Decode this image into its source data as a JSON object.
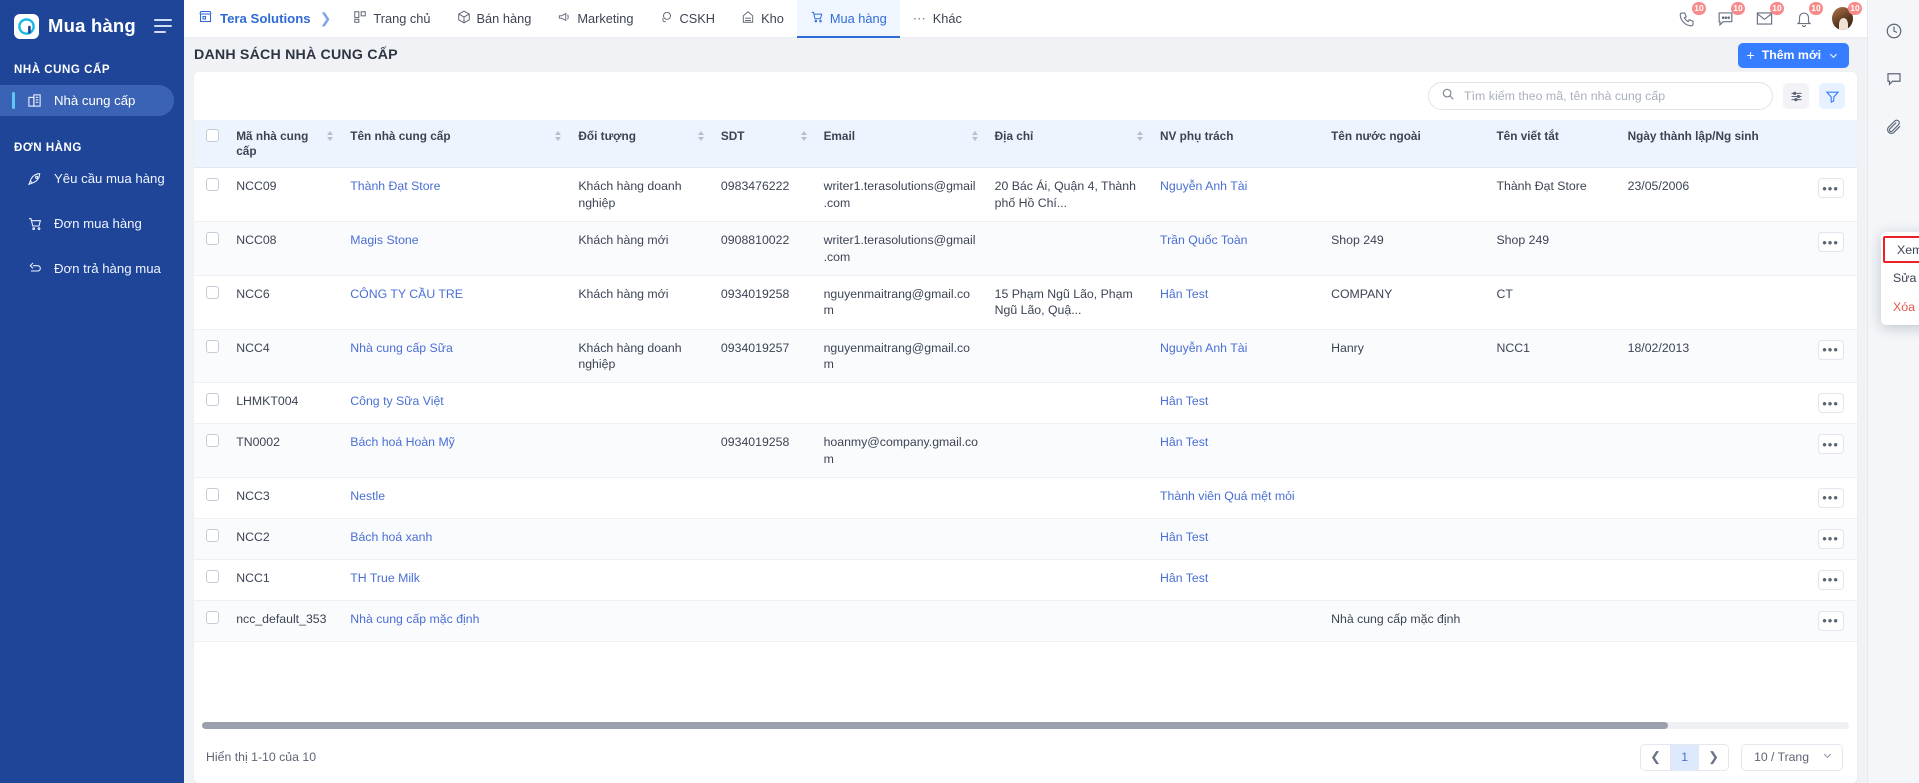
{
  "sidebar": {
    "app_title": "Mua hàng",
    "groups": [
      {
        "label": "NHÀ CUNG CẤP",
        "items": [
          {
            "label": "Nhà cung cấp",
            "icon": "building-icon",
            "active": true
          }
        ]
      },
      {
        "label": "ĐƠN HÀNG",
        "items": [
          {
            "label": "Yêu cầu mua hàng",
            "icon": "rocket-icon",
            "active": false
          },
          {
            "label": "Đơn mua hàng",
            "icon": "cart-icon",
            "active": false
          },
          {
            "label": "Đơn trả hàng mua",
            "icon": "return-arrow-icon",
            "active": false
          }
        ]
      }
    ]
  },
  "topnav": {
    "brand": "Tera Solutions",
    "items": [
      {
        "label": "Trang chủ",
        "icon": "dashboard-icon",
        "active": false
      },
      {
        "label": "Bán hàng",
        "icon": "box-icon",
        "active": false
      },
      {
        "label": "Marketing",
        "icon": "megaphone-icon",
        "active": false
      },
      {
        "label": "CSKH",
        "icon": "headset-icon",
        "active": false
      },
      {
        "label": "Kho",
        "icon": "warehouse-icon",
        "active": false
      },
      {
        "label": "Mua hàng",
        "icon": "cart-icon",
        "active": true
      },
      {
        "label": "Khác",
        "icon": "dots-icon",
        "active": false
      }
    ],
    "actions": [
      {
        "name": "phone-icon",
        "badge": "10"
      },
      {
        "name": "chat-icon",
        "badge": "10"
      },
      {
        "name": "mail-icon",
        "badge": "10"
      },
      {
        "name": "bell-icon",
        "badge": "10"
      },
      {
        "name": "avatar",
        "badge": "10"
      }
    ]
  },
  "page": {
    "title": "DANH SÁCH NHÀ CUNG CẤP",
    "add_button": "Thêm mới"
  },
  "toolbar": {
    "search_placeholder": "Tìm kiếm theo mã, tên nhà cung cấp",
    "search_value": "",
    "settings_icon": "sliders-icon",
    "filter_icon": "funnel-icon"
  },
  "table": {
    "columns": [
      {
        "label": "Mã nhà cung cấp",
        "sortable": true
      },
      {
        "label": "Tên nhà cung cấp",
        "sortable": true
      },
      {
        "label": "Đối tượng",
        "sortable": true
      },
      {
        "label": "SDT",
        "sortable": true
      },
      {
        "label": "Email",
        "sortable": true
      },
      {
        "label": "Địa chỉ",
        "sortable": true
      },
      {
        "label": "NV phụ trách",
        "sortable": false
      },
      {
        "label": "Tên nước ngoài",
        "sortable": false
      },
      {
        "label": "Tên viết tắt",
        "sortable": false
      },
      {
        "label": "Ngày thành lập/Ng sinh",
        "sortable": false
      }
    ],
    "rows": [
      {
        "code": "NCC09",
        "name": "Thành Đạt Store",
        "object": "Khách hàng doanh nghiệp",
        "phone": "0983476222",
        "email": "writer1.terasolutions@gmail.com",
        "address": "20 Bác Ái, Quận 4, Thành phố Hồ Chí...",
        "staff": "Nguyễn Anh Tài",
        "foreign_name": "",
        "short_name": "Thành Đạt Store",
        "date": "23/05/2006"
      },
      {
        "code": "NCC08",
        "name": "Magis Stone",
        "object": "Khách hàng mới",
        "phone": "0908810022",
        "email": "writer1.terasolutions@gmail.com",
        "address": "",
        "staff": "Trần Quốc Toàn",
        "foreign_name": "Shop 249",
        "short_name": "Shop 249",
        "date": ""
      },
      {
        "code": "NCC6",
        "name": "CÔNG TY CẦU TRE",
        "object": "Khách hàng mới",
        "phone": "0934019258",
        "email": "nguyenmaitrang@gmail.com",
        "address": "15 Phạm Ngũ Lão, Phạm Ngũ Lão, Quậ...",
        "staff": "Hân Test",
        "foreign_name": "COMPANY",
        "short_name": "CT",
        "date": ""
      },
      {
        "code": "NCC4",
        "name": "Nhà cung cấp Sữa",
        "object": "Khách hàng doanh nghiệp",
        "phone": "0934019257",
        "email": "nguyenmaitrang@gmail.com",
        "address": "",
        "staff": "Nguyễn Anh Tài",
        "foreign_name": "Hanry",
        "short_name": "NCC1",
        "date": "18/02/2013"
      },
      {
        "code": "LHMKT004",
        "name": "Công ty Sữa Việt",
        "object": "",
        "phone": "",
        "email": "",
        "address": "",
        "staff": "Hân Test",
        "foreign_name": "",
        "short_name": "",
        "date": ""
      },
      {
        "code": "TN0002",
        "name": "Bách hoá Hoàn Mỹ",
        "object": "",
        "phone": "0934019258",
        "email": "hoanmy@company.gmail.com",
        "address": "",
        "staff": "Hân Test",
        "foreign_name": "",
        "short_name": "",
        "date": ""
      },
      {
        "code": "NCC3",
        "name": "Nestle",
        "object": "",
        "phone": "",
        "email": "",
        "address": "",
        "staff": "Thành viên Quá mệt mỏi",
        "foreign_name": "",
        "short_name": "",
        "date": ""
      },
      {
        "code": "NCC2",
        "name": "Bách hoá xanh",
        "object": "",
        "phone": "",
        "email": "",
        "address": "",
        "staff": "Hân Test",
        "foreign_name": "",
        "short_name": "",
        "date": ""
      },
      {
        "code": "NCC1",
        "name": "TH True Milk",
        "object": "",
        "phone": "",
        "email": "",
        "address": "",
        "staff": "Hân Test",
        "foreign_name": "",
        "short_name": "",
        "date": ""
      },
      {
        "code": "ncc_default_353",
        "name": "Nhà cung cấp mặc định",
        "object": "",
        "phone": "",
        "email": "",
        "address": "",
        "staff": "",
        "foreign_name": "Nhà cung cấp mặc định",
        "short_name": "",
        "date": ""
      }
    ],
    "row_action_label": "•••"
  },
  "context_menu": {
    "items": [
      {
        "label": "Xem",
        "highlighted": true,
        "danger": false
      },
      {
        "label": "Sửa",
        "highlighted": false,
        "danger": false
      },
      {
        "label": "Xóa",
        "highlighted": false,
        "danger": true
      }
    ]
  },
  "footer": {
    "showing": "Hiển thị 1-10 của 10",
    "current_page": "1",
    "page_size": "10 / Trang"
  },
  "rail": {
    "items": [
      {
        "name": "clock-icon"
      },
      {
        "name": "comment-icon"
      },
      {
        "name": "attachment-icon"
      }
    ]
  },
  "colors": {
    "sidebar_bg": "#1f4599",
    "accent": "#377dff",
    "link": "#4a6fd4",
    "danger": "#e2574c",
    "highlight_border": "#ec2027"
  }
}
